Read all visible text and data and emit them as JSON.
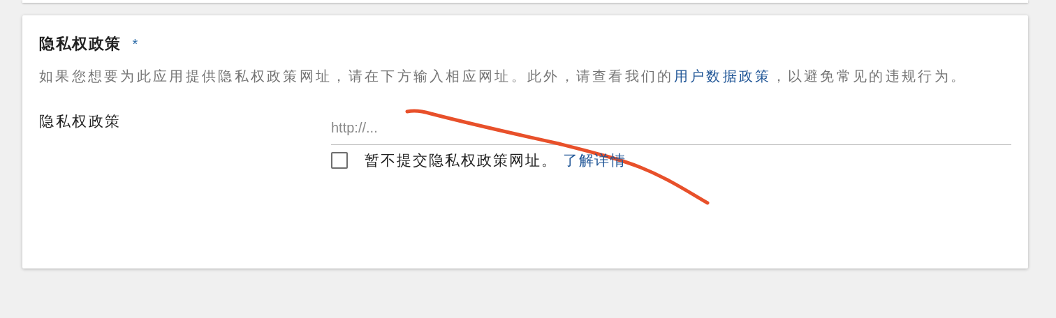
{
  "section": {
    "title": "隐私权政策",
    "required_mark": "*",
    "description": {
      "before": "如果您想要为此应用提供隐私权政策网址，请在下方输入相应网址。此外，请查看我们的",
      "link": "用户数据政策",
      "after": "，以避免常见的违规行为。"
    }
  },
  "field": {
    "label": "隐私权政策",
    "placeholder": "http://..."
  },
  "opt_out": {
    "label": "暂不提交隐私权政策网址。",
    "checked": false,
    "link": "了解详情"
  }
}
